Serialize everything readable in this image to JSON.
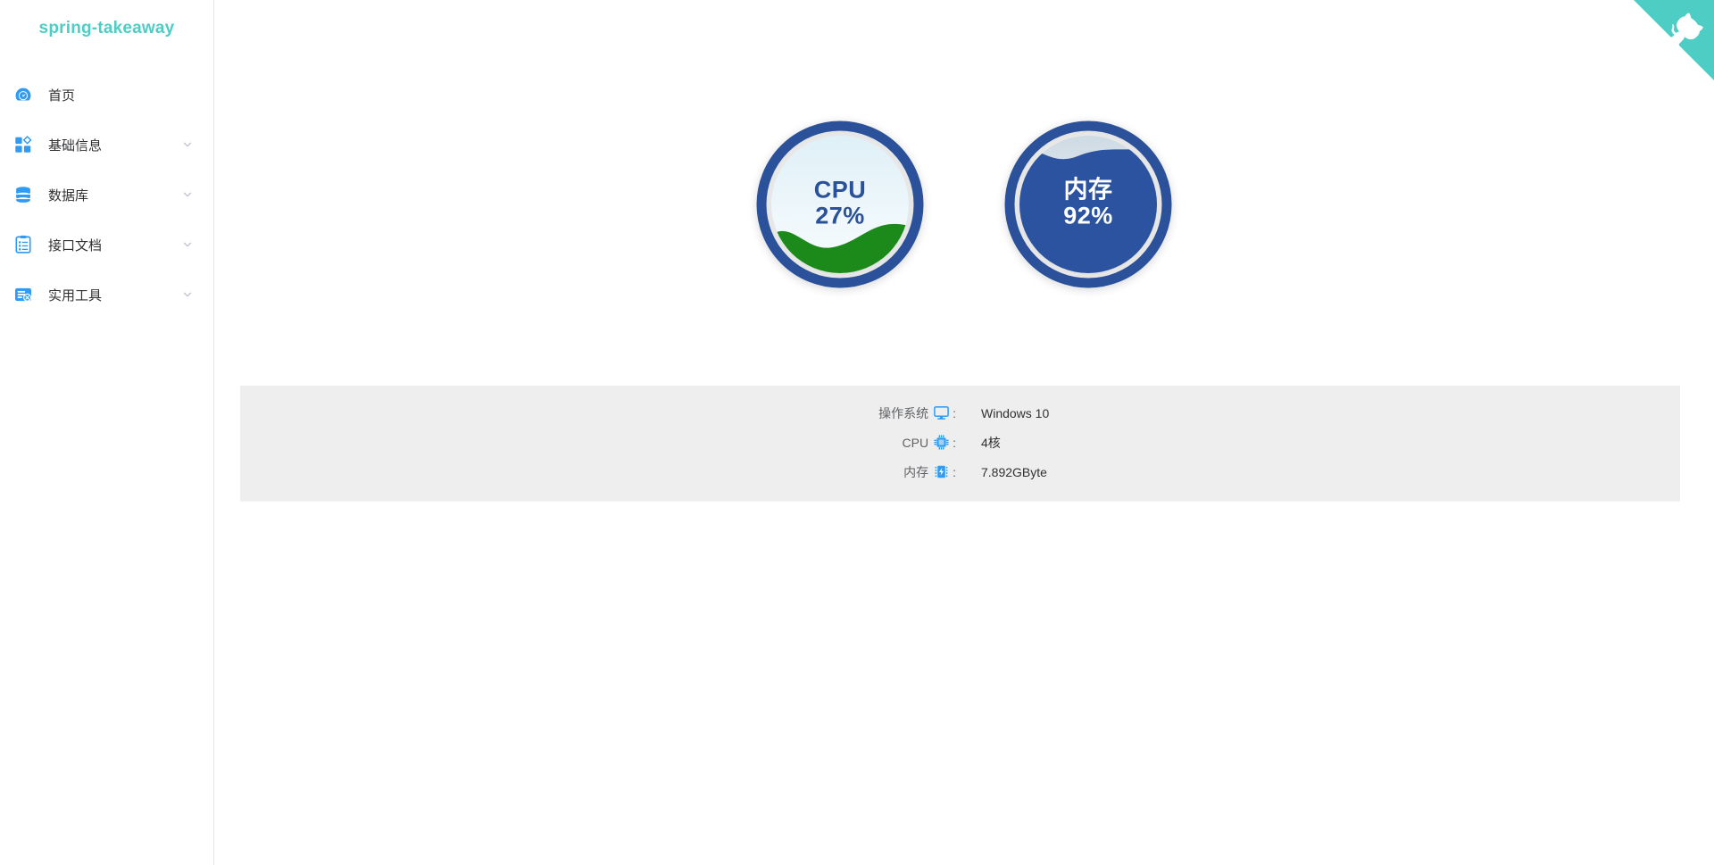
{
  "app": {
    "logo": "spring-takeaway",
    "accent_teal": "#4ecdc4",
    "icon_blue": "#2f9bf2",
    "gauge_ring": "#2a5199",
    "cpu_wave": "#1b8a1b",
    "mem_fill": "#2b539f",
    "panel_bg": "#eeeeee"
  },
  "sidebar": {
    "items": [
      {
        "label": "首页",
        "icon": "dashboard-icon",
        "has_chevron": false
      },
      {
        "label": "基础信息",
        "icon": "blocks-icon",
        "has_chevron": true
      },
      {
        "label": "数据库",
        "icon": "database-icon",
        "has_chevron": true
      },
      {
        "label": "接口文档",
        "icon": "clipboard-icon",
        "has_chevron": true
      },
      {
        "label": "实用工具",
        "icon": "toolbox-icon",
        "has_chevron": true
      }
    ]
  },
  "corner": {
    "icon": "octocat-icon",
    "color": "#4ecdc4"
  },
  "gauges": [
    {
      "title": "CPU",
      "value": "27%",
      "percent": 27,
      "style": "cpu",
      "name": "cpu-gauge"
    },
    {
      "title": "内存",
      "value": "92%",
      "percent": 92,
      "style": "mem",
      "name": "memory-gauge"
    }
  ],
  "info": {
    "rows": [
      {
        "label": "操作系统",
        "icon": "monitor-icon",
        "colon": ":",
        "value": "Windows 10"
      },
      {
        "label": "CPU",
        "icon": "chip-icon",
        "colon": ":",
        "value": "4核"
      },
      {
        "label": "内存",
        "icon": "battery-icon",
        "colon": ":",
        "value": "7.892GByte"
      }
    ]
  }
}
